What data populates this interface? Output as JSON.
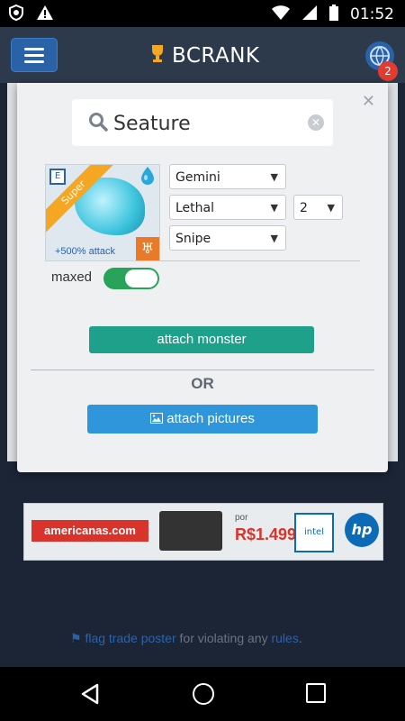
{
  "statusbar": {
    "time": "01:52"
  },
  "header": {
    "brand": "BCRANK",
    "notification_count": "2"
  },
  "search": {
    "value": "Seature",
    "clear_icon": "clear-icon"
  },
  "monster": {
    "ribbon": "Super",
    "elite_mark": "E",
    "bonus": "+500% attack",
    "zodiac_glyph": "♅"
  },
  "selects": {
    "book": "Gemini",
    "trait": "Lethal",
    "level": "2",
    "role": "Snipe"
  },
  "maxed": {
    "label": "maxed",
    "on": true
  },
  "actions": {
    "attach_monster": "attach monster",
    "or": "OR",
    "attach_pictures": "attach pictures"
  },
  "ad": {
    "retailer": "americanas.com",
    "price_label": "por",
    "price": "R$1.499",
    "intel": "intel",
    "hp": "hp"
  },
  "footer": {
    "flag_link": "flag trade poster",
    "middle": "for violating any",
    "rules_link": "rules",
    "end": "."
  },
  "colors": {
    "accent_green": "#1fa08a",
    "accent_blue": "#2f96dc",
    "toggle_on": "#27a35a",
    "badge_red": "#e33b2e"
  }
}
